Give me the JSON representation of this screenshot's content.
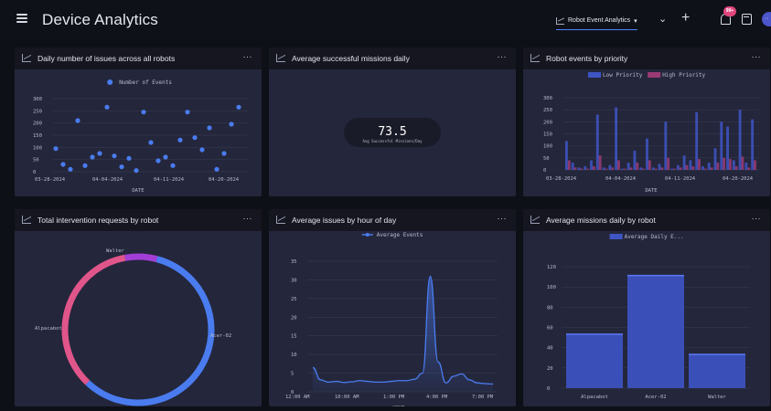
{
  "header": {
    "title": "Device Analytics",
    "dashboard_select": "Robot Event Analytics",
    "notification_badge": "99+",
    "avatar_initials": "··"
  },
  "panels": [
    {
      "title": "Daily number of issues across all robots",
      "more": "···"
    },
    {
      "title": "Average successful missions daily",
      "more": "···"
    },
    {
      "title": "Robot events by priority",
      "more": "···"
    },
    {
      "title": "Total intervention requests by robot",
      "more": "···"
    },
    {
      "title": "Average issues by hour of day",
      "more": "···"
    },
    {
      "title": "Average missions daily by robot",
      "more": "···"
    }
  ],
  "colors": {
    "blue": "#4a7cf0",
    "pink": "#e0558a",
    "purple": "#a23ed6",
    "panel": "#24263b",
    "header": "#15161f"
  },
  "chart_data": [
    {
      "type": "scatter",
      "title": "Daily number of issues across all robots",
      "legend": [
        "Number of Events"
      ],
      "xlabel": "DATE",
      "ylabel": "",
      "x_ticks": [
        "03-28-2024",
        "04-04-2024",
        "04-11-2024",
        "04-20-2024"
      ],
      "y_ticks": [
        0,
        50,
        100,
        150,
        200,
        250,
        300
      ],
      "ylim": [
        0,
        300
      ],
      "x": [
        0,
        1,
        2,
        3,
        4,
        5,
        6,
        7,
        8,
        9,
        10,
        11,
        12,
        13,
        14,
        15,
        16,
        17,
        18,
        19,
        20,
        21,
        22,
        23,
        24,
        25
      ],
      "values": [
        95,
        30,
        10,
        210,
        25,
        60,
        75,
        265,
        65,
        20,
        55,
        5,
        245,
        120,
        45,
        60,
        25,
        130,
        245,
        140,
        90,
        180,
        10,
        75,
        195,
        265
      ],
      "legend_position": "top-center"
    },
    {
      "type": "table",
      "title": "Average successful missions daily",
      "value": "73.5",
      "caption": "Avg Successful Missions/Day"
    },
    {
      "type": "bar",
      "title": "Robot events by priority",
      "xlabel": "DATE",
      "x_ticks": [
        "03-28-2024",
        "04-04-2024",
        "04-11-2024",
        "04-20-2024"
      ],
      "y_ticks": [
        0,
        50,
        100,
        150,
        200,
        250,
        300
      ],
      "ylim": [
        0,
        300
      ],
      "series": [
        {
          "name": "Low Priority",
          "values": [
            120,
            30,
            10,
            15,
            40,
            230,
            10,
            20,
            260,
            5,
            30,
            80,
            10,
            130,
            10,
            25,
            200,
            5,
            20,
            60,
            40,
            240,
            15,
            30,
            90,
            200,
            180,
            40,
            250,
            30,
            210
          ]
        },
        {
          "name": "High Priority",
          "values": [
            40,
            10,
            5,
            5,
            15,
            60,
            5,
            10,
            40,
            5,
            10,
            30,
            5,
            40,
            5,
            10,
            50,
            5,
            10,
            20,
            15,
            45,
            5,
            10,
            30,
            50,
            45,
            15,
            55,
            10,
            40
          ]
        }
      ],
      "legend_position": "top-center"
    },
    {
      "type": "pie",
      "title": "Total intervention requests by robot",
      "categories": [
        "Walter",
        "Acer-02",
        "Alpacabot"
      ],
      "values": [
        7,
        58,
        35
      ]
    },
    {
      "type": "line",
      "title": "Average issues by hour of day",
      "legend": [
        "Average Events"
      ],
      "xlabel": "HOUR",
      "x_ticks": [
        "12:00 AM",
        "10:00 AM",
        "1:00 PM",
        "4:00 PM",
        "7:00 PM"
      ],
      "y_ticks": [
        0,
        5,
        10,
        15,
        20,
        25,
        30,
        35
      ],
      "ylim": [
        0,
        35
      ],
      "x": [
        0,
        1,
        2,
        3,
        4,
        5,
        6,
        7,
        8,
        9,
        10,
        11,
        12,
        13,
        14,
        15,
        16,
        17,
        18,
        19,
        20,
        21,
        22,
        23
      ],
      "values": [
        6.5,
        3.2,
        2.6,
        2.8,
        2.5,
        2.7,
        3.0,
        2.8,
        2.6,
        2.6,
        2.8,
        3.0,
        3.0,
        3.4,
        5.0,
        31.0,
        8.0,
        2.4,
        4.2,
        4.8,
        3.2,
        2.4,
        2.2,
        2.1
      ],
      "legend_position": "top-center"
    },
    {
      "type": "bar",
      "title": "Average missions daily by robot",
      "legend": [
        "Average Daily E..."
      ],
      "categories": [
        "Alpacabot",
        "Acer-02",
        "Walter"
      ],
      "values": [
        54,
        112,
        34
      ],
      "xlabel": "ROBOT",
      "y_ticks": [
        0,
        20,
        40,
        60,
        80,
        100,
        120
      ],
      "ylim": [
        0,
        130
      ],
      "legend_position": "top-center"
    }
  ]
}
